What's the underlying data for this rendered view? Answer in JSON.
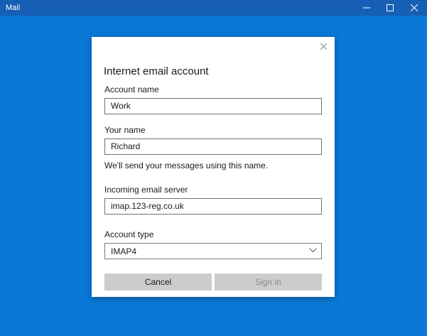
{
  "app": {
    "title": "Mail"
  },
  "dialog": {
    "title": "Internet email account",
    "account_name": {
      "label": "Account name",
      "value": "Work"
    },
    "your_name": {
      "label": "Your name",
      "value": "Richard"
    },
    "helper_text": "We'll send your messages using this name.",
    "incoming_server": {
      "label": "Incoming email server",
      "value": "imap.123-reg.co.uk"
    },
    "account_type": {
      "label": "Account type",
      "selected": "IMAP4"
    },
    "cancel_label": "Cancel",
    "signin_label": "Sign in"
  },
  "colors": {
    "titlebar": "#175fb4",
    "background": "#0978d6",
    "button_bg": "#cccccc",
    "disabled_text": "#8a8a8a"
  },
  "icons": {
    "minimize": "minimize-icon",
    "maximize": "maximize-icon",
    "close": "close-icon",
    "dialog_close": "close-icon",
    "dropdown": "chevron-down-icon"
  }
}
